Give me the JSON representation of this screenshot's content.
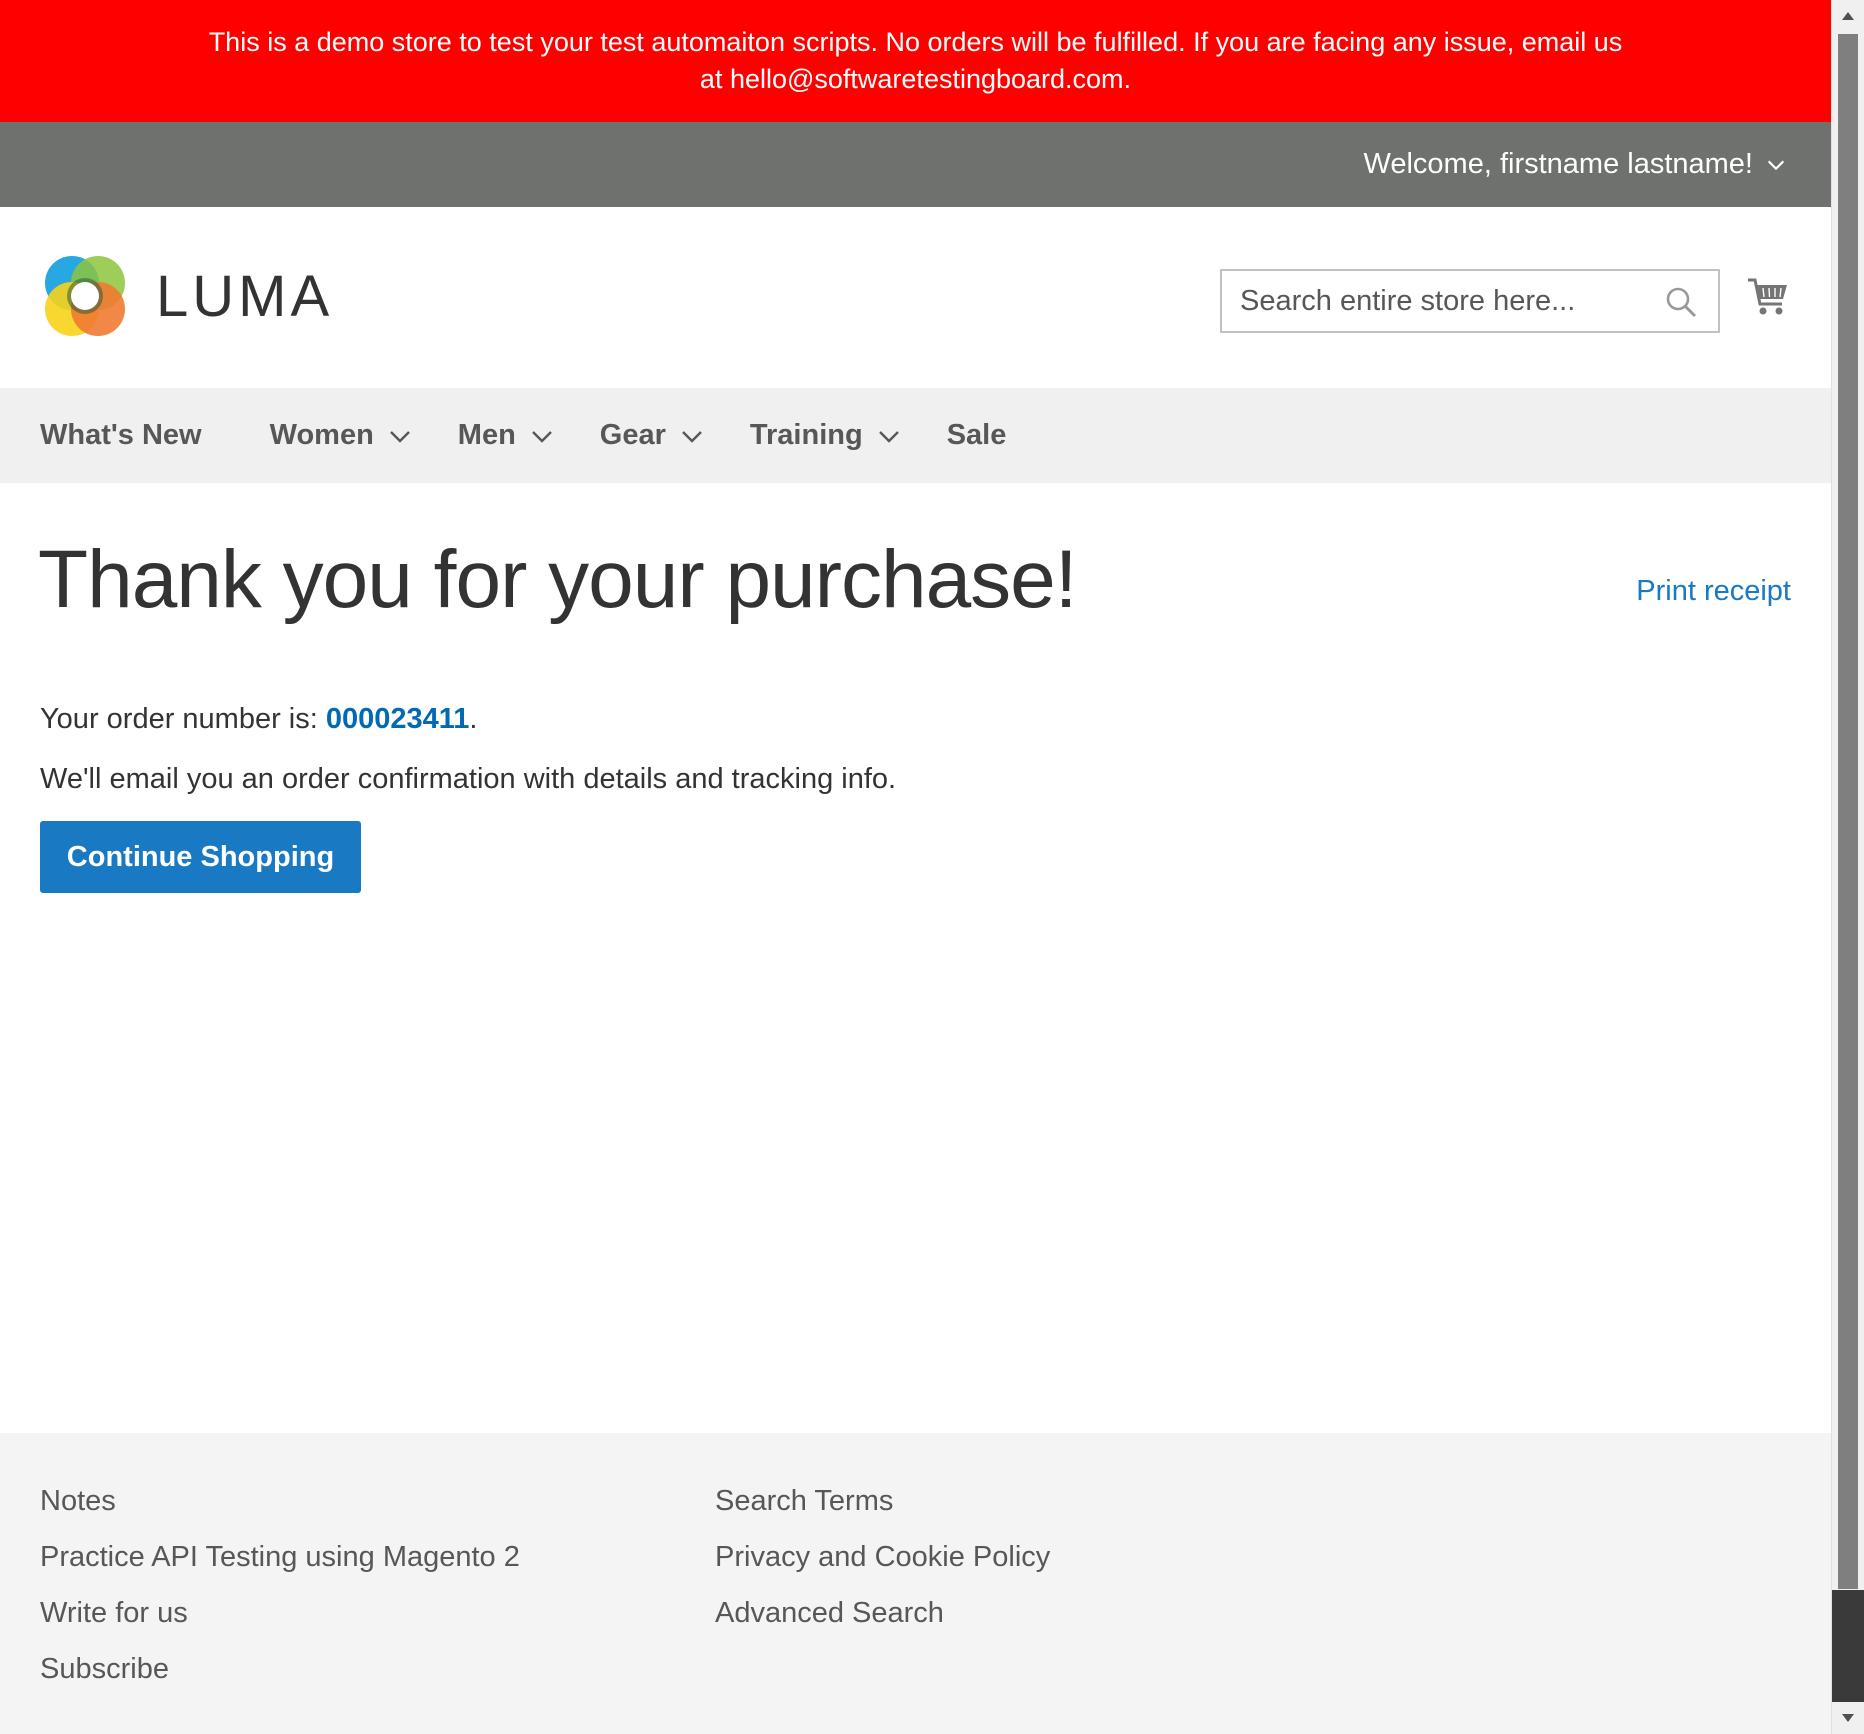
{
  "demo_notice": {
    "text": "This is a demo store to test your test automaiton scripts. No orders will be fulfilled. If you are facing any issue, email us at hello@softwaretestingboard.com."
  },
  "header": {
    "welcome": "Welcome, firstname lastname!",
    "logo_text": "LUMA",
    "search_placeholder": "Search entire store here...",
    "icons": {
      "search": "search-icon",
      "cart": "cart-icon",
      "dropdown": "chevron-down-icon"
    }
  },
  "nav": {
    "items": [
      {
        "label": "What's New",
        "has_dropdown": false
      },
      {
        "label": "Women",
        "has_dropdown": true
      },
      {
        "label": "Men",
        "has_dropdown": true
      },
      {
        "label": "Gear",
        "has_dropdown": true
      },
      {
        "label": "Training",
        "has_dropdown": true
      },
      {
        "label": "Sale",
        "has_dropdown": false
      }
    ]
  },
  "main": {
    "title": "Thank you for your purchase!",
    "print_receipt": "Print receipt",
    "order_prefix": "Your order number is: ",
    "order_number": "000023411",
    "order_suffix": ".",
    "email_text": "We'll email you an order confirmation with details and tracking info.",
    "continue_button": "Continue Shopping"
  },
  "footer": {
    "left_links": [
      "Notes",
      "Practice API Testing using Magento 2",
      "Write for us",
      "Subscribe"
    ],
    "right_links": [
      "Search Terms",
      "Privacy and Cookie Policy",
      "Advanced Search"
    ]
  },
  "colors": {
    "notice_bg": "#ff0000",
    "header_bar": "#6e716e",
    "nav_bg": "#f0f0f0",
    "primary_button": "#1979c3",
    "link": "#006bb4",
    "footer_bg": "#f4f4f4"
  }
}
